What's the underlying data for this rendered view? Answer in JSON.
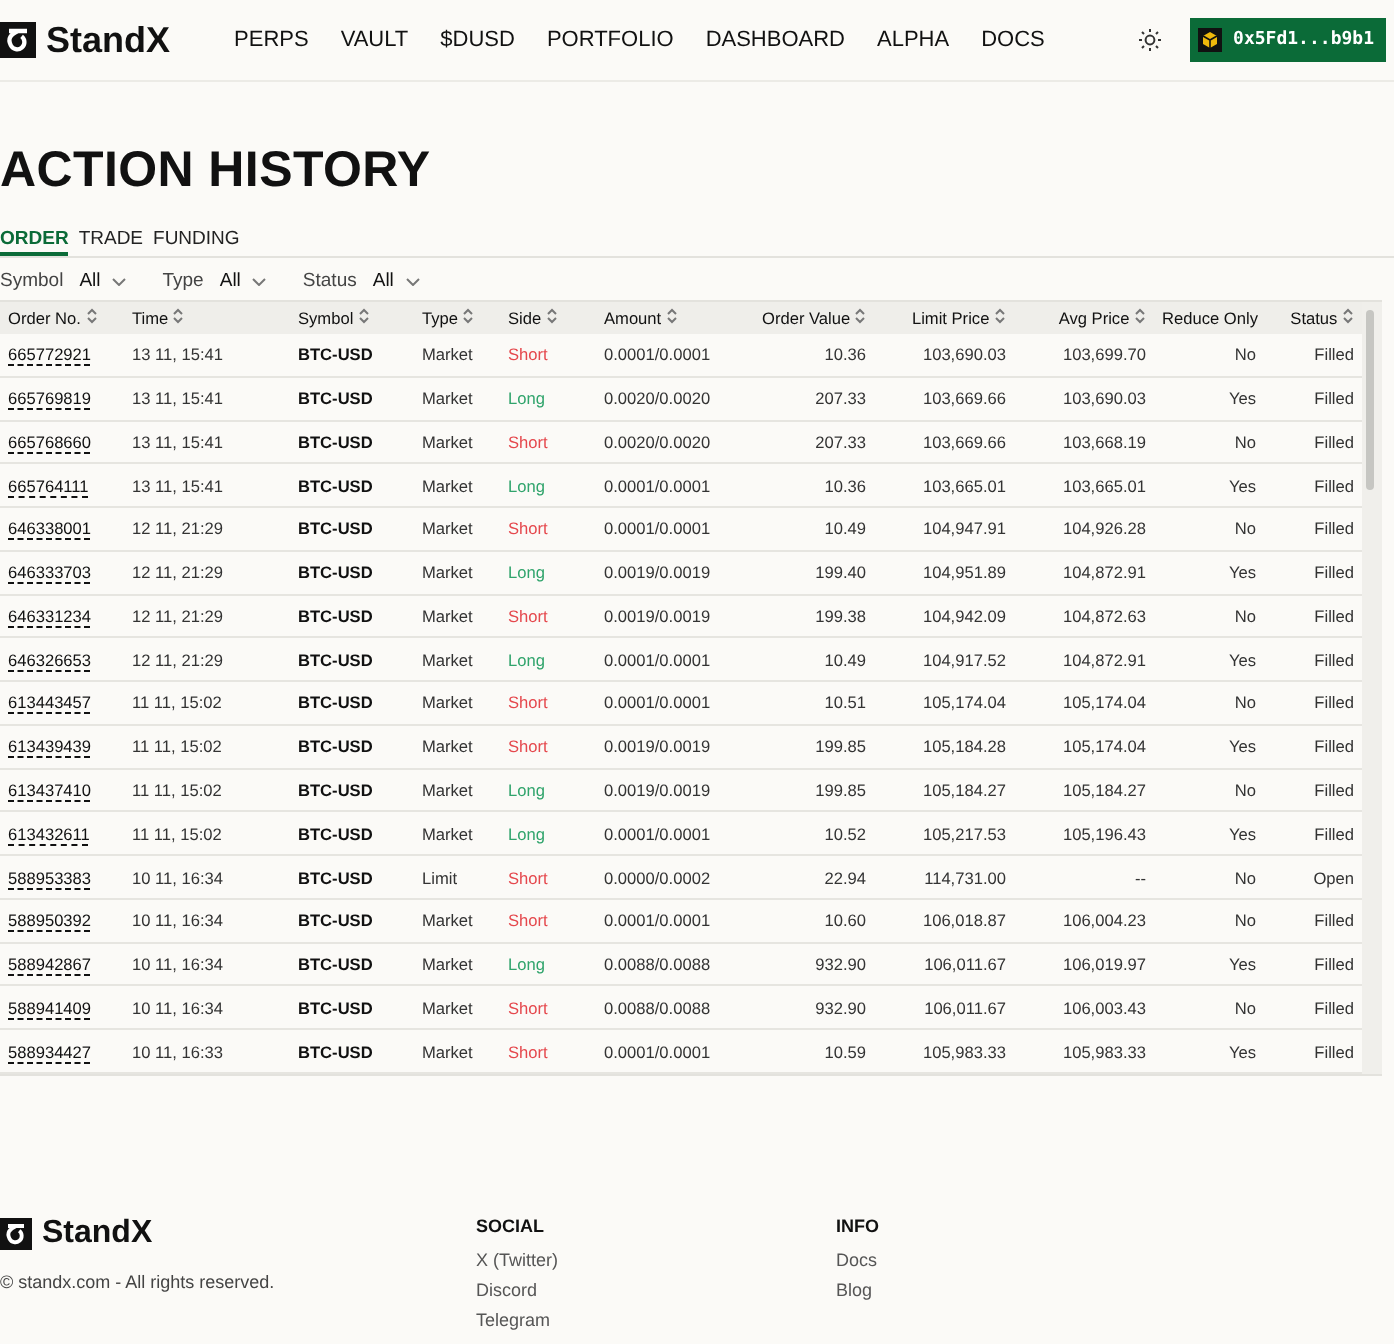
{
  "header": {
    "logo": "StandX",
    "nav": [
      "PERPS",
      "VAULT",
      "$DUSD",
      "PORTFOLIO",
      "DASHBOARD",
      "ALPHA",
      "DOCS"
    ],
    "wallet": "0x5Fd1...b9b1"
  },
  "title": "ACTION HISTORY",
  "tabs": [
    {
      "label": "ORDER",
      "selected": true
    },
    {
      "label": "TRADE",
      "selected": false
    },
    {
      "label": "FUNDING",
      "selected": false
    }
  ],
  "filters": [
    {
      "label": "Symbol",
      "value": "All"
    },
    {
      "label": "Type",
      "value": "All"
    },
    {
      "label": "Status",
      "value": "All"
    }
  ],
  "table": {
    "columns": [
      {
        "label": "Order No.",
        "sortable": true
      },
      {
        "label": "Time",
        "sortable": true
      },
      {
        "label": "Symbol",
        "sortable": true
      },
      {
        "label": "Type",
        "sortable": true
      },
      {
        "label": "Side",
        "sortable": true
      },
      {
        "label": "Amount",
        "sortable": true
      },
      {
        "label": "Order Value",
        "sortable": true
      },
      {
        "label": "Limit Price",
        "sortable": true
      },
      {
        "label": "Avg Price",
        "sortable": true
      },
      {
        "label": "Reduce Only",
        "sortable": false
      },
      {
        "label": "Status",
        "sortable": true
      }
    ],
    "rows": [
      {
        "cells": [
          "665772921",
          "13 11, 15:41",
          "BTC-USD",
          "Market",
          "Short",
          "0.0001/0.0001",
          "10.36",
          "103,690.03",
          "103,699.70",
          "No",
          "Filled"
        ],
        "color": "#e5484d"
      },
      {
        "cells": [
          "665769819",
          "13 11, 15:41",
          "BTC-USD",
          "Market",
          "Long",
          "0.0020/0.0020",
          "207.33",
          "103,669.66",
          "103,690.03",
          "Yes",
          "Filled"
        ],
        "color": "#30a46c"
      },
      {
        "cells": [
          "665768660",
          "13 11, 15:41",
          "BTC-USD",
          "Market",
          "Short",
          "0.0020/0.0020",
          "207.33",
          "103,669.66",
          "103,668.19",
          "No",
          "Filled"
        ],
        "color": "#e5484d"
      },
      {
        "cells": [
          "665764111",
          "13 11, 15:41",
          "BTC-USD",
          "Market",
          "Long",
          "0.0001/0.0001",
          "10.36",
          "103,665.01",
          "103,665.01",
          "Yes",
          "Filled"
        ],
        "color": "#30a46c"
      },
      {
        "cells": [
          "646338001",
          "12 11, 21:29",
          "BTC-USD",
          "Market",
          "Short",
          "0.0001/0.0001",
          "10.49",
          "104,947.91",
          "104,926.28",
          "No",
          "Filled"
        ],
        "color": "#e5484d"
      },
      {
        "cells": [
          "646333703",
          "12 11, 21:29",
          "BTC-USD",
          "Market",
          "Long",
          "0.0019/0.0019",
          "199.40",
          "104,951.89",
          "104,872.91",
          "Yes",
          "Filled"
        ],
        "color": "#30a46c"
      },
      {
        "cells": [
          "646331234",
          "12 11, 21:29",
          "BTC-USD",
          "Market",
          "Short",
          "0.0019/0.0019",
          "199.38",
          "104,942.09",
          "104,872.63",
          "No",
          "Filled"
        ],
        "color": "#e5484d"
      },
      {
        "cells": [
          "646326653",
          "12 11, 21:29",
          "BTC-USD",
          "Market",
          "Long",
          "0.0001/0.0001",
          "10.49",
          "104,917.52",
          "104,872.91",
          "Yes",
          "Filled"
        ],
        "color": "#30a46c"
      },
      {
        "cells": [
          "613443457",
          "11 11, 15:02",
          "BTC-USD",
          "Market",
          "Short",
          "0.0001/0.0001",
          "10.51",
          "105,174.04",
          "105,174.04",
          "No",
          "Filled"
        ],
        "color": "#e5484d"
      },
      {
        "cells": [
          "613439439",
          "11 11, 15:02",
          "BTC-USD",
          "Market",
          "Short",
          "0.0019/0.0019",
          "199.85",
          "105,184.28",
          "105,174.04",
          "Yes",
          "Filled"
        ],
        "color": "#e5484d"
      },
      {
        "cells": [
          "613437410",
          "11 11, 15:02",
          "BTC-USD",
          "Market",
          "Long",
          "0.0019/0.0019",
          "199.85",
          "105,184.27",
          "105,184.27",
          "No",
          "Filled"
        ],
        "color": "#30a46c"
      },
      {
        "cells": [
          "613432611",
          "11 11, 15:02",
          "BTC-USD",
          "Market",
          "Long",
          "0.0001/0.0001",
          "10.52",
          "105,217.53",
          "105,196.43",
          "Yes",
          "Filled"
        ],
        "color": "#30a46c"
      },
      {
        "cells": [
          "588953383",
          "10 11, 16:34",
          "BTC-USD",
          "Limit",
          "Short",
          "0.0000/0.0002",
          "22.94",
          "114,731.00",
          "--",
          "No",
          "Open"
        ],
        "color": "#e5484d"
      },
      {
        "cells": [
          "588950392",
          "10 11, 16:34",
          "BTC-USD",
          "Market",
          "Short",
          "0.0001/0.0001",
          "10.60",
          "106,018.87",
          "106,004.23",
          "No",
          "Filled"
        ],
        "color": "#e5484d"
      },
      {
        "cells": [
          "588942867",
          "10 11, 16:34",
          "BTC-USD",
          "Market",
          "Long",
          "0.0088/0.0088",
          "932.90",
          "106,011.67",
          "106,019.97",
          "Yes",
          "Filled"
        ],
        "color": "#30a46c"
      },
      {
        "cells": [
          "588941409",
          "10 11, 16:34",
          "BTC-USD",
          "Market",
          "Short",
          "0.0088/0.0088",
          "932.90",
          "106,011.67",
          "106,003.43",
          "No",
          "Filled"
        ],
        "color": "#e5484d"
      },
      {
        "cells": [
          "588934427",
          "10 11, 16:33",
          "BTC-USD",
          "Market",
          "Short",
          "0.0001/0.0001",
          "10.59",
          "105,983.33",
          "105,983.33",
          "Yes",
          "Filled"
        ],
        "color": "#e5484d"
      }
    ]
  },
  "footer": {
    "logo": "StandX",
    "copyright": "© standx.com - All rights reserved.",
    "columns": [
      {
        "heading": "SOCIAL",
        "links": [
          "X (Twitter)",
          "Discord",
          "Telegram"
        ]
      },
      {
        "heading": "INFO",
        "links": [
          "Docs",
          "Blog"
        ]
      }
    ]
  }
}
